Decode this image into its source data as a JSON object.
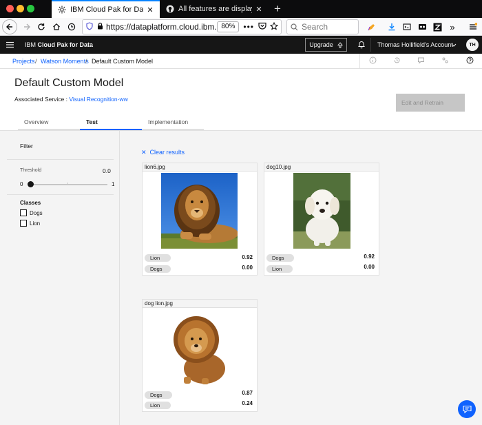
{
  "browser": {
    "tabs": [
      {
        "label": "IBM Cloud Pak for Data",
        "favicon": "ibm-icon"
      },
      {
        "label": "All features are displayed as St",
        "favicon": "github-icon"
      }
    ],
    "url_text": "https://dataplatform.cloud.ibm.",
    "zoom": "80%",
    "search_placeholder": "Search"
  },
  "app": {
    "title_prefix": "IBM",
    "title_main": "Cloud Pak for Data",
    "upgrade_label": "Upgrade",
    "account_label": "Thomas Hollifield's Account",
    "avatar_initials": "TH"
  },
  "breadcrumb": {
    "items": [
      "Projects",
      "Watson Moments",
      "Default Custom Model"
    ]
  },
  "header": {
    "title": "Default Custom Model",
    "assoc_prefix": "Associated Service : ",
    "assoc_link": "Visual Recognition-ww",
    "retrain_button": "Edit and Retrain",
    "tabs": [
      "Overview",
      "Test",
      "Implementation"
    ]
  },
  "filter": {
    "title": "Filter",
    "threshold_label": "Threshold",
    "threshold_value": "0.0",
    "threshold_fraction": 0.0,
    "slider_min": "0",
    "slider_max": "1",
    "classes_title": "Classes",
    "classes": [
      "Dogs",
      "Lion"
    ]
  },
  "results": {
    "clear_label": "Clear results",
    "cards": [
      {
        "filename": "lion6.jpg",
        "scores": [
          {
            "label": "Lion",
            "value": "0.92"
          },
          {
            "label": "Dogs",
            "value": "0.00"
          }
        ]
      },
      {
        "filename": "dog10.jpg",
        "scores": [
          {
            "label": "Dogs",
            "value": "0.92"
          },
          {
            "label": "Lion",
            "value": "0.00"
          }
        ]
      },
      {
        "filename": "dog lion.jpg",
        "scores": [
          {
            "label": "Dogs",
            "value": "0.87"
          },
          {
            "label": "Lion",
            "value": "0.24"
          }
        ]
      }
    ]
  },
  "colors": {
    "accent": "#0f62fe",
    "masthead": "#161616",
    "page_bg": "#f4f4f4",
    "disabled_button": "#c6c6c6"
  }
}
